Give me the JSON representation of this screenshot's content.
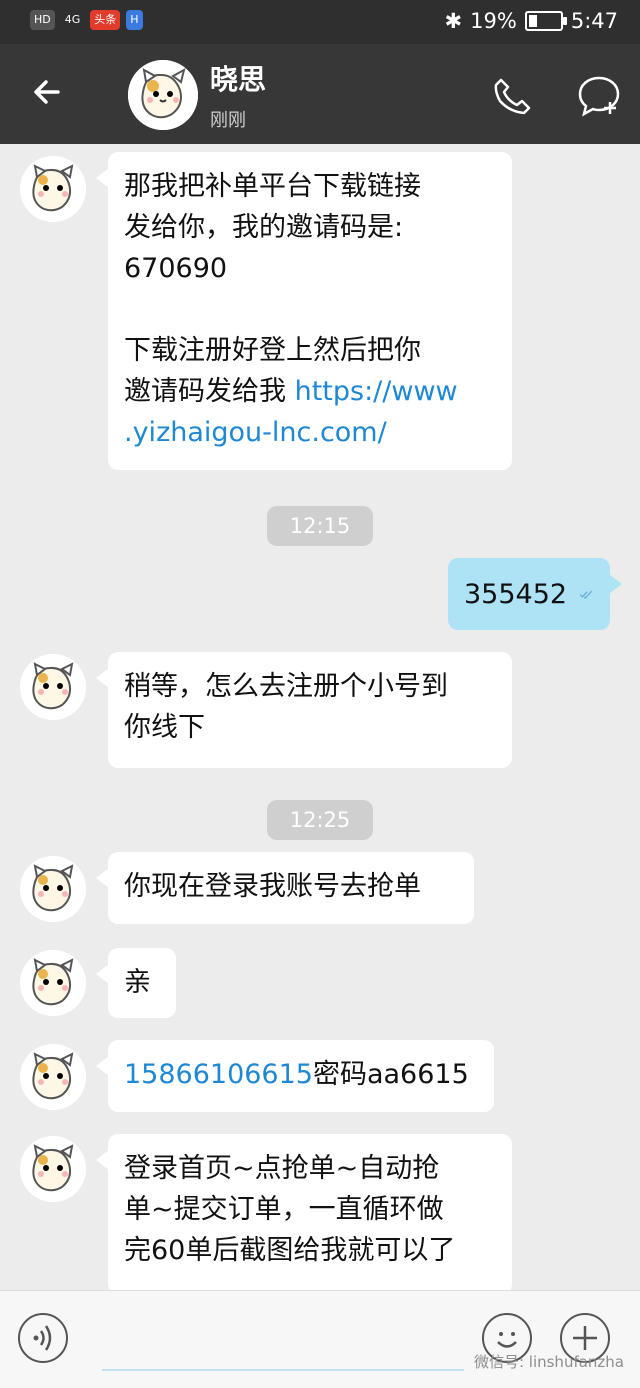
{
  "status_bar": {
    "left_chips": [
      "HD",
      "4G",
      "头条",
      "H"
    ],
    "battery_percent": "19%",
    "time": "5:47"
  },
  "header": {
    "back_icon": "arrow-left-icon",
    "title": "晓思",
    "subtitle": "刚刚",
    "call_icon": "phone-icon",
    "new_message_icon": "chat-plus-icon"
  },
  "messages": [
    {
      "sender": "other",
      "paragraphs": [
        "那我把补单平台下载链接",
        "发给你，我的邀请码是:",
        "670690"
      ],
      "paragraphs2": [
        "下载注册好登上然后把你",
        "邀请码发给我 "
      ],
      "link_text": "https://www",
      "link_text2": ".yizhaigou-lnc.com/"
    },
    {
      "type": "time",
      "text": "12:15"
    },
    {
      "sender": "me",
      "text": "355452",
      "status": "read"
    },
    {
      "sender": "other",
      "text": [
        "稍等，怎么去注册个小号到",
        "你线下"
      ]
    },
    {
      "type": "time",
      "text": "12:25"
    },
    {
      "sender": "other",
      "text": [
        "你现在登录我账号去抢单"
      ]
    },
    {
      "sender": "other",
      "text": [
        "亲"
      ]
    },
    {
      "sender": "other",
      "phone": "15866106615",
      "text": "密码aa6615"
    },
    {
      "sender": "other",
      "text": [
        "登录首页~点抢单~自动抢",
        "单~提交订单，一直循环做",
        "完60单后截图给我就可以了"
      ]
    }
  ],
  "bottom_bar": {
    "voice_icon": "voice-icon",
    "emoji_icon": "emoji-icon",
    "plus_icon": "plus-icon",
    "watermark": "微信号: linshufanzha"
  }
}
